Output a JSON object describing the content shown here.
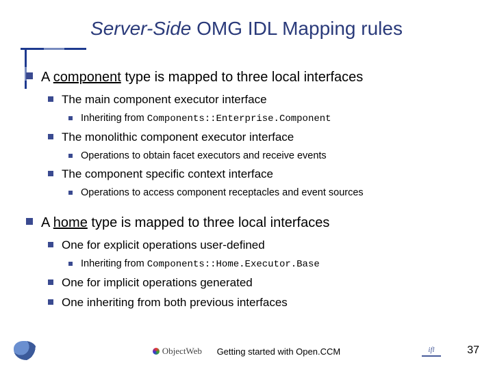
{
  "title": {
    "italic": "Server-Side",
    "rest": " OMG IDL Mapping rules"
  },
  "bullets": [
    {
      "text_parts": [
        {
          "t": "A "
        },
        {
          "t": "component",
          "u": true
        },
        {
          "t": " type is mapped to three local interfaces"
        }
      ],
      "children": [
        {
          "text": "The main component executor interface",
          "children": [
            {
              "text_parts": [
                {
                  "t": "Inheriting from "
                },
                {
                  "t": "Components::Enterprise.Component",
                  "code": true
                }
              ]
            }
          ]
        },
        {
          "text": "The monolithic component executor interface",
          "children": [
            {
              "text": "Operations to obtain facet executors and receive events"
            }
          ]
        },
        {
          "text": "The component specific context interface",
          "children": [
            {
              "text": "Operations to access component receptacles and event sources"
            }
          ]
        }
      ]
    },
    {
      "text_parts": [
        {
          "t": "A "
        },
        {
          "t": "home",
          "u": true
        },
        {
          "t": " type is mapped to three local interfaces"
        }
      ],
      "children": [
        {
          "text": "One for explicit operations user-defined",
          "children": [
            {
              "text_parts": [
                {
                  "t": "Inheriting from "
                },
                {
                  "t": "Components::Home.Executor.Base",
                  "code": true
                }
              ]
            }
          ]
        },
        {
          "text": "One for implicit operations generated"
        },
        {
          "text": "One inheriting from both previous interfaces"
        }
      ]
    }
  ],
  "footer": {
    "objectweb": "ObjectWeb",
    "caption": "Getting started with Open.CCM",
    "logo2": "ifl",
    "page": "37"
  }
}
